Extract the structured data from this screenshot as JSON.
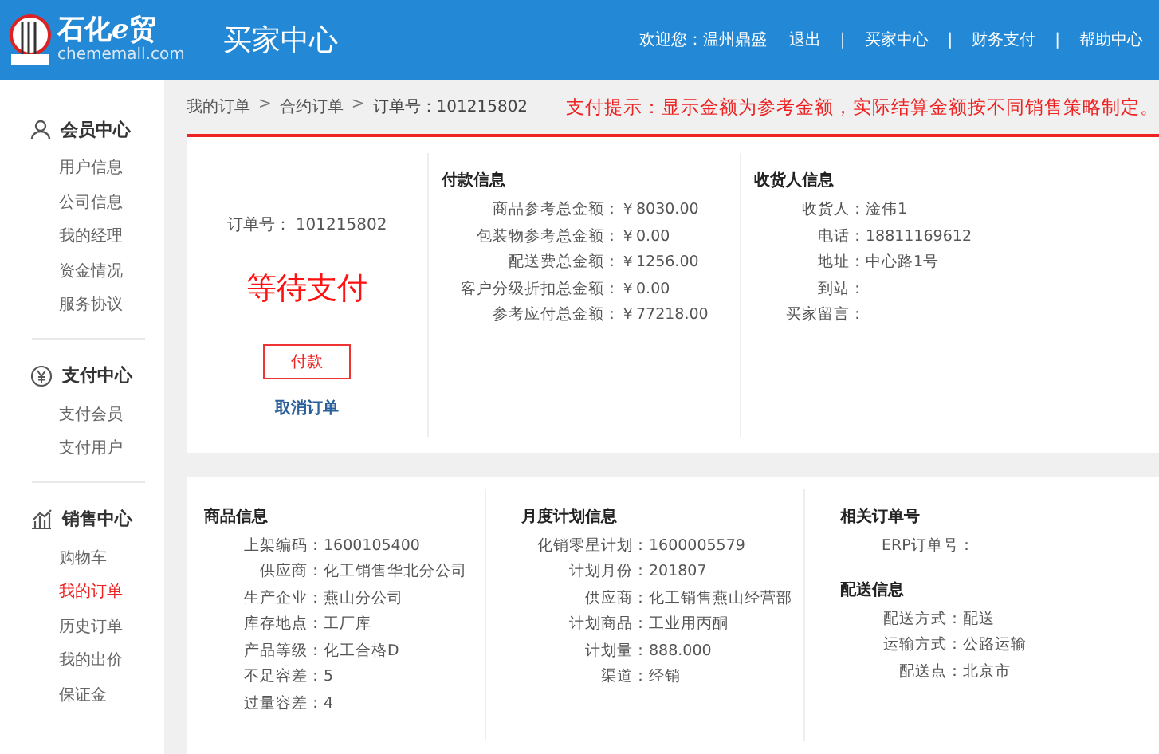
{
  "header": {
    "logo_name": "石化",
    "logo_e": "e",
    "logo_trade": "贸",
    "logo_domain": "chememall.com",
    "title": "买家中心",
    "welcome": "欢迎您：",
    "user": "温州鼎盛",
    "nav": [
      {
        "kind": "link",
        "text": "退出"
      },
      {
        "kind": "separator",
        "text": "|"
      },
      {
        "kind": "link",
        "text": "买家中心"
      },
      {
        "kind": "separator",
        "text": "|"
      },
      {
        "kind": "link",
        "text": "财务支付"
      },
      {
        "kind": "separator",
        "text": "|"
      },
      {
        "kind": "link",
        "text": "帮助中心"
      }
    ]
  },
  "sidebar": {
    "groups": [
      {
        "title": "会员中心",
        "items": [
          {
            "label": "用户信息",
            "selected": false
          },
          {
            "label": "公司信息",
            "selected": false
          },
          {
            "label": "我的经理",
            "selected": false
          },
          {
            "label": "资金情况",
            "selected": false
          },
          {
            "label": "服务协议",
            "selected": false
          }
        ]
      },
      {
        "title": "支付中心",
        "items": [
          {
            "label": "支付会员",
            "selected": false
          },
          {
            "label": "支付用户",
            "selected": false
          }
        ]
      },
      {
        "title": "销售中心",
        "items": [
          {
            "label": "购物车",
            "selected": false
          },
          {
            "label": "我的订单",
            "selected": true
          },
          {
            "label": "历史订单",
            "selected": false
          },
          {
            "label": "我的出价",
            "selected": false
          },
          {
            "label": "保证金",
            "selected": false
          }
        ]
      }
    ]
  },
  "breadcrumb": [
    {
      "kind": "link",
      "text": "我的订单"
    },
    {
      "kind": "separator",
      "text": ">"
    },
    {
      "kind": "link",
      "text": "合约订单"
    },
    {
      "kind": "separator",
      "text": ">"
    },
    {
      "kind": "current",
      "text": "订单号：101215802"
    }
  ],
  "payment_tip": "支付提示：显示金额为参考金额，实际结算金额按不同销售策略制定。",
  "order": {
    "number_label": "订单号：",
    "number": "101215802",
    "status": "等待支付",
    "pay_button": "付款",
    "cancel_link": "取消订单"
  },
  "top_sections": [
    {
      "title": "付款信息",
      "rows": [
        {
          "label": "商品参考总金额：",
          "value": "￥8030.00"
        },
        {
          "label": "包装物参考总金额：",
          "value": "￥0.00"
        },
        {
          "label": "配送费总金额：",
          "value": "￥1256.00"
        },
        {
          "label": "客户分级折扣总金额：",
          "value": "￥0.00"
        },
        {
          "label": "参考应付总金额：",
          "value": "￥77218.00"
        }
      ]
    },
    {
      "title": "收货人信息",
      "rows": [
        {
          "label": "收货人：",
          "value": "淦伟1"
        },
        {
          "label": "电话：",
          "value": "18811169612"
        },
        {
          "label": "地址：",
          "value": "中心路1号"
        },
        {
          "label": "到站：",
          "value": ""
        },
        {
          "label": "买家留言：",
          "value": ""
        }
      ]
    }
  ],
  "bottom_columns": [
    [
      {
        "title": "商品信息",
        "rows": [
          {
            "label": "上架编码：",
            "value": "1600105400"
          },
          {
            "label": "供应商：",
            "value": "化工销售华北分公司"
          },
          {
            "label": "生产企业：",
            "value": "燕山分公司"
          },
          {
            "label": "库存地点：",
            "value": "工厂库"
          },
          {
            "label": "产品等级：",
            "value": "化工合格D"
          },
          {
            "label": "不足容差：",
            "value": "5"
          },
          {
            "label": "过量容差：",
            "value": "4"
          }
        ]
      }
    ],
    [
      {
        "title": "月度计划信息",
        "rows": [
          {
            "label": "化销零星计划：",
            "value": "1600005579"
          },
          {
            "label": "计划月份：",
            "value": "201807"
          },
          {
            "label": "供应商：",
            "value": "化工销售燕山经营部"
          },
          {
            "label": "计划商品：",
            "value": "工业用丙酮"
          },
          {
            "label": "计划量：",
            "value": "888.000"
          },
          {
            "label": "渠道：",
            "value": "经销"
          }
        ]
      }
    ],
    [
      {
        "title": "相关订单号",
        "rows": [
          {
            "label": "ERP订单号：",
            "value": ""
          }
        ]
      },
      {
        "title": "配送信息",
        "rows": [
          {
            "label": "配送方式：",
            "value": "配送"
          },
          {
            "label": "运输方式：",
            "value": "公路运输"
          },
          {
            "label": "配送点：",
            "value": "北京市"
          }
        ]
      }
    ]
  ]
}
